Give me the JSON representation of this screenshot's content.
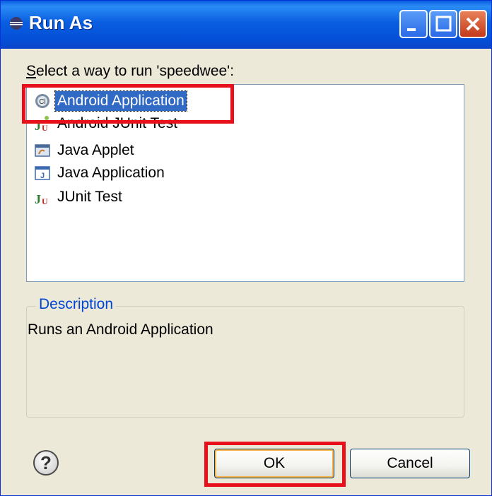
{
  "window": {
    "title": "Run As"
  },
  "prompt": {
    "text_prefix": "",
    "underlined": "S",
    "text_rest": "elect a way to run 'speedwee':"
  },
  "launch_list": {
    "items": [
      {
        "label": "Android Application",
        "icon": "android-icon",
        "selected": true
      },
      {
        "label": "Android JUnit Test",
        "icon": "junit-android-icon",
        "selected": false
      },
      {
        "label": "Java Applet",
        "icon": "java-applet-icon",
        "selected": false
      },
      {
        "label": "Java Application",
        "icon": "java-application-icon",
        "selected": false
      },
      {
        "label": "JUnit Test",
        "icon": "junit-icon",
        "selected": false
      }
    ]
  },
  "description": {
    "legend": "Description",
    "text": "Runs an Android Application"
  },
  "buttons": {
    "help": "?",
    "ok": "OK",
    "cancel": "Cancel"
  },
  "colors": {
    "titlebar": "#0a5ee0",
    "selection": "#316ac5",
    "highlight_box": "#e8101a",
    "legend_text": "#0046d5"
  }
}
